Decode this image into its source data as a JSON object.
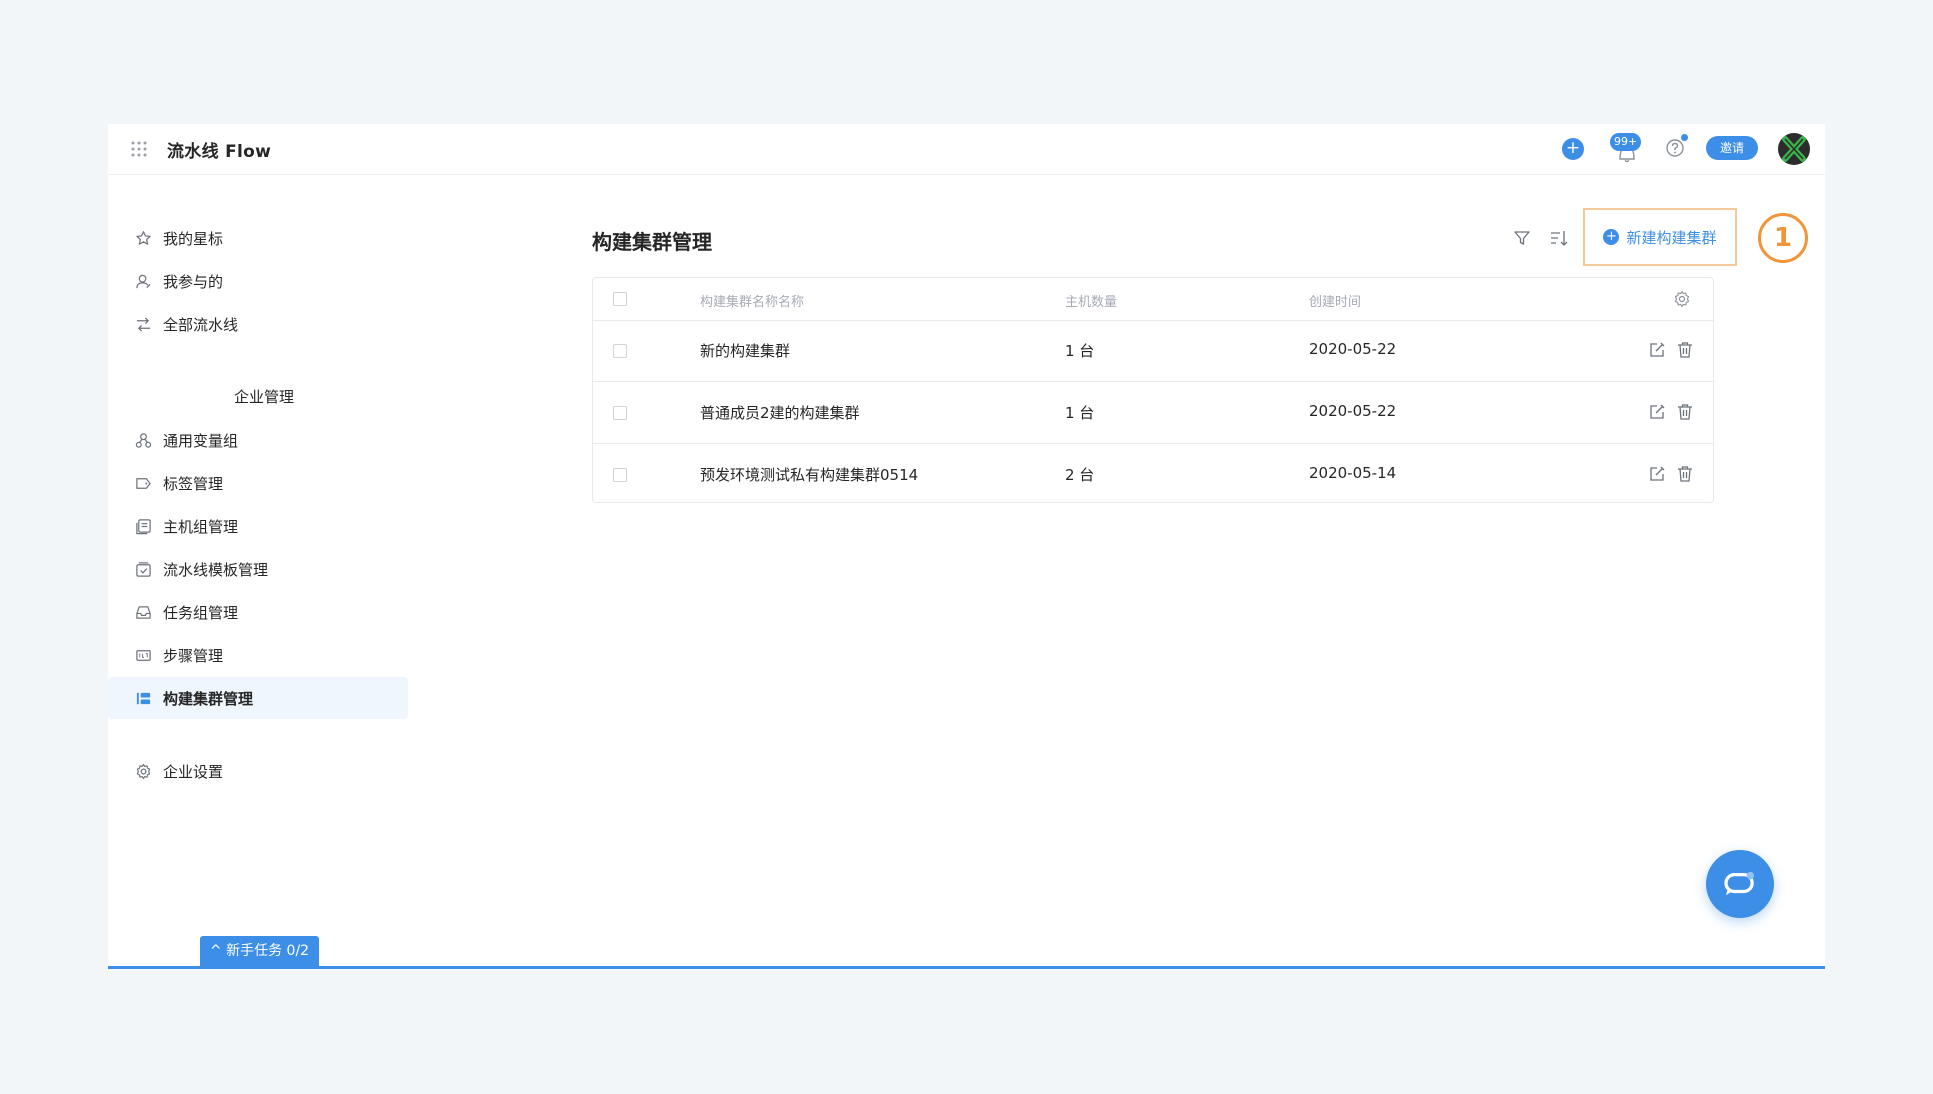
{
  "app": {
    "title": "流水线 Flow"
  },
  "topbar": {
    "notification_badge": "99+",
    "invite_label": "邀请"
  },
  "sidebar": {
    "items_top": [
      {
        "label": "我的星标",
        "icon": "star-icon"
      },
      {
        "label": "我参与的",
        "icon": "user-icon"
      },
      {
        "label": "全部流水线",
        "icon": "flow-icon"
      }
    ],
    "section_label": "企业管理",
    "items_enterprise": [
      {
        "label": "通用变量组",
        "icon": "variable-icon"
      },
      {
        "label": "标签管理",
        "icon": "tag-icon"
      },
      {
        "label": "主机组管理",
        "icon": "host-icon"
      },
      {
        "label": "流水线模板管理",
        "icon": "template-icon"
      },
      {
        "label": "任务组管理",
        "icon": "inbox-icon"
      },
      {
        "label": "步骤管理",
        "icon": "steps-icon"
      },
      {
        "label": "构建集群管理",
        "icon": "cluster-icon",
        "active": true
      }
    ],
    "settings_label": "企业设置"
  },
  "main": {
    "title": "构建集群管理",
    "new_button_label": "新建构建集群",
    "step_marker": "1",
    "table": {
      "columns": [
        "构建集群名称名称",
        "主机数量",
        "创建时间"
      ],
      "rows": [
        {
          "name": "新的构建集群",
          "hosts": "1 台",
          "created": "2020-05-22"
        },
        {
          "name": "普通成员2建的构建集群",
          "hosts": "1 台",
          "created": "2020-05-22"
        },
        {
          "name": "预发环境测试私有构建集群0514",
          "hosts": "2 台",
          "created": "2020-05-14"
        }
      ]
    }
  },
  "footer": {
    "task_tab_label": "^ 新手任务 0/2"
  },
  "colors": {
    "accent": "#3d8ee6",
    "highlight": "#f0953a",
    "background": "#f3f6f9"
  }
}
